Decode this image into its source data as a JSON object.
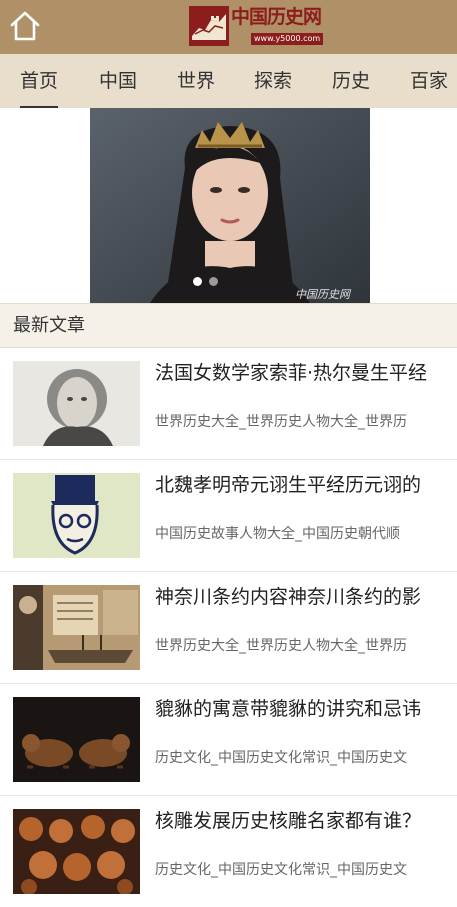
{
  "header": {
    "logo_text": "中国历史网",
    "logo_url": "www.y5000.com",
    "brand_color": "#8c1d1d",
    "header_color": "#b09167"
  },
  "nav": {
    "items": [
      "首页",
      "中国",
      "世界",
      "探索",
      "历史",
      "百家"
    ],
    "active_index": 0,
    "background": "#e9decb"
  },
  "banner": {
    "watermark": "中国历史网",
    "slide_count": 2,
    "active_slide": 0
  },
  "section": {
    "title": "最新文章"
  },
  "articles": [
    {
      "title": "法国女数学家索菲·热尔曼生平经",
      "tags": "世界历史大全_世界历史人物大全_世界历"
    },
    {
      "title": "北魏孝明帝元诩生平经历元诩的",
      "tags": "中国历史故事人物大全_中国历史朝代顺"
    },
    {
      "title": "神奈川条约内容神奈川条约的影",
      "tags": "世界历史大全_世界历史人物大全_世界历"
    },
    {
      "title": "貔貅的寓意带貔貅的讲究和忌讳",
      "tags": "历史文化_中国历史文化常识_中国历史文"
    },
    {
      "title": "核雕发展历史核雕名家都有谁？",
      "tags": "历史文化_中国历史文化常识_中国历史文"
    }
  ]
}
